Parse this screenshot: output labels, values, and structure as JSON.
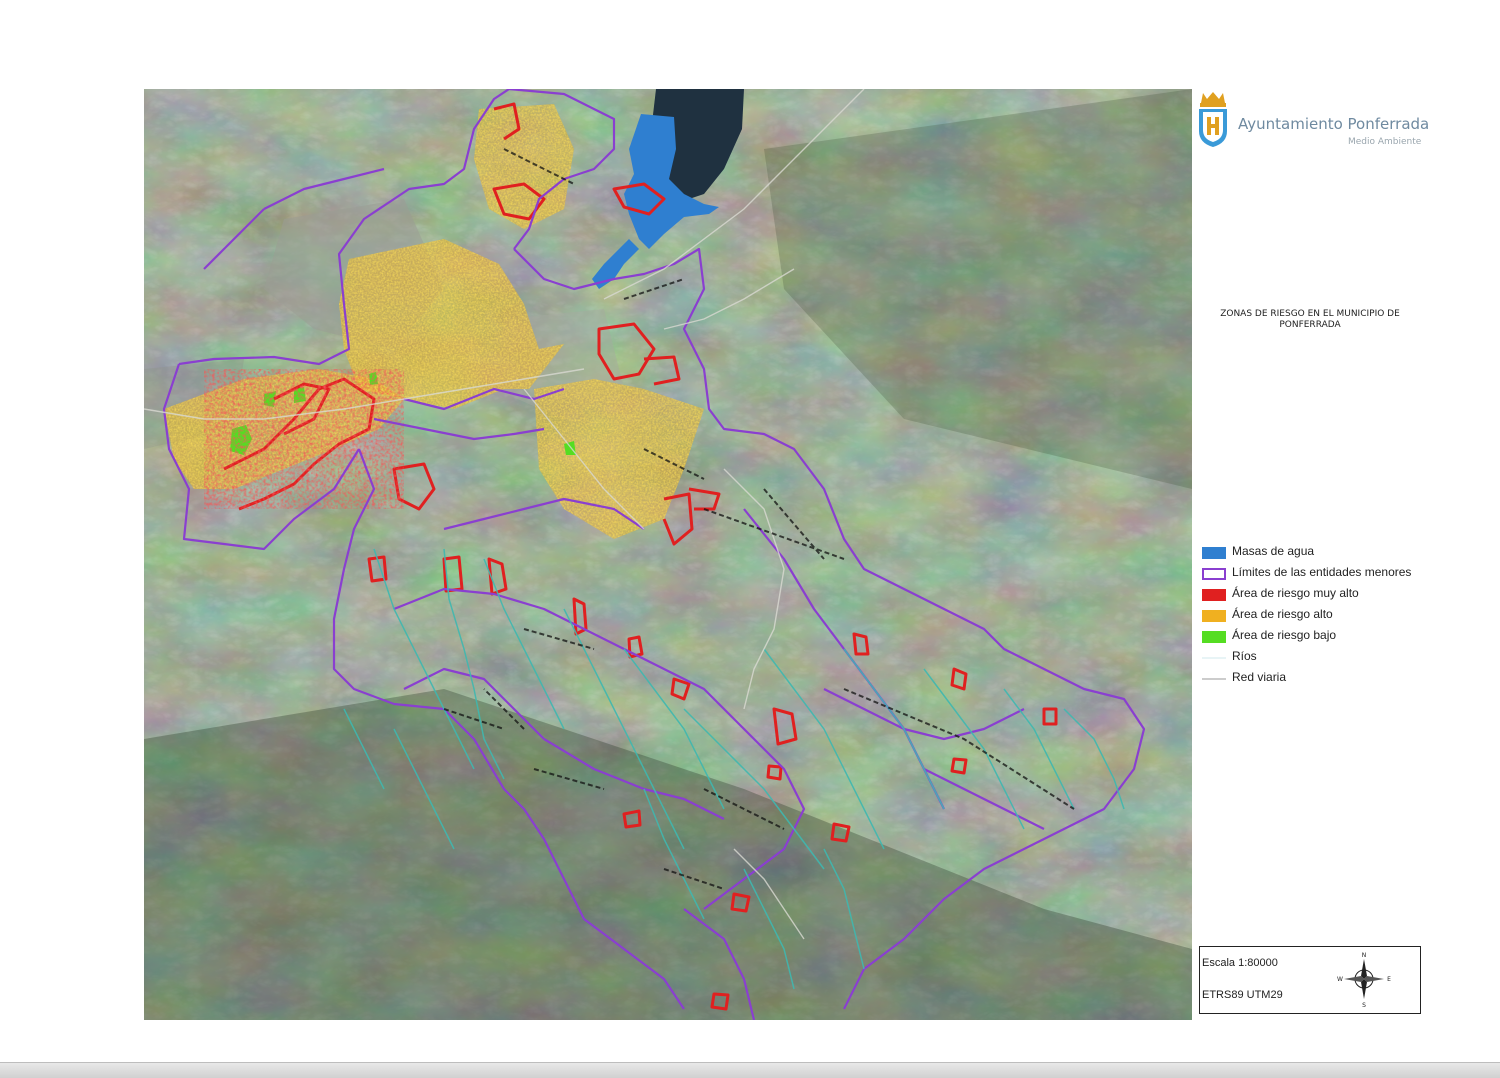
{
  "header": {
    "organization": "Ayuntamiento Ponferrada",
    "department": "Medio Ambiente"
  },
  "map": {
    "title": "ZONAS DE RIESGO EN EL MUNICIPIO DE PONFERRADA",
    "basemap": "satellite-imagery",
    "legend": [
      {
        "label": "Masas de agua",
        "color": "#2f7fd0",
        "kind": "fill"
      },
      {
        "label": "Límites de las entidades menores",
        "color": "#8a3fd0",
        "kind": "outline"
      },
      {
        "label": "Área de riesgo muy alto",
        "color": "#e02020",
        "kind": "fill"
      },
      {
        "label": "Área de riesgo alto",
        "color": "#f0b020",
        "kind": "fill"
      },
      {
        "label": "Área de riesgo bajo",
        "color": "#55dd22",
        "kind": "fill"
      },
      {
        "label": "Ríos",
        "color": "#e8f4f6",
        "kind": "line"
      },
      {
        "label": "Red viaria",
        "color": "#cccccc",
        "kind": "line"
      }
    ],
    "scale": {
      "label": "Escala 1:80000",
      "projection": "ETRS89 UTM29"
    },
    "north_arrow": {
      "n": "N",
      "s": "S",
      "e": "E",
      "w": "W"
    }
  },
  "icons": {
    "logo": "city-shield-icon",
    "compass": "compass-rose-icon"
  },
  "colors": {
    "river_line": "#3fb8b0",
    "boundary": "#8a3fd0",
    "water": "#2f7fd0",
    "very_high": "#e02020",
    "high": "#f0b020",
    "low": "#55dd22"
  }
}
